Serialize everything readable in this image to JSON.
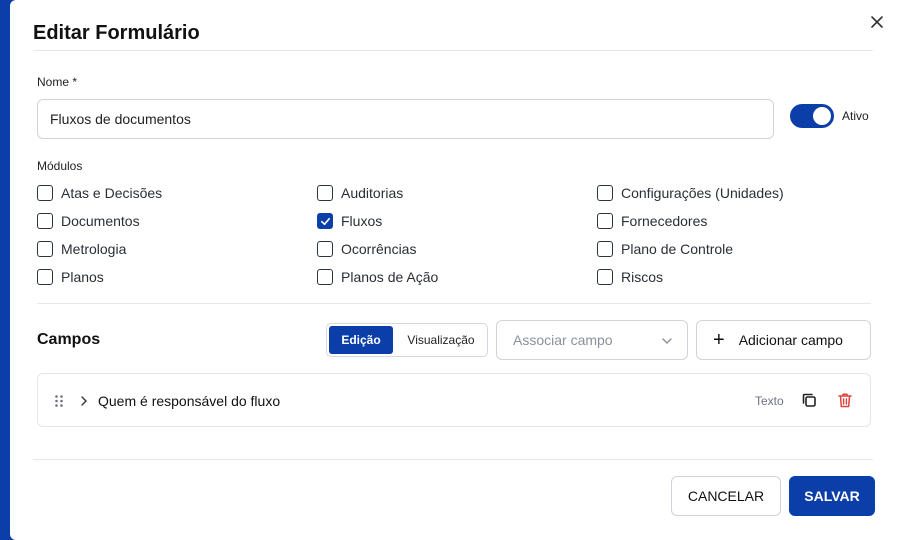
{
  "modal": {
    "title": "Editar Formulário",
    "name_label": "Nome *",
    "name_value": "Fluxos de documentos",
    "toggle_label": "Ativo",
    "toggle_on": true,
    "modules_label": "Módulos",
    "modules": [
      {
        "label": "Atas e Decisões",
        "checked": false
      },
      {
        "label": "Auditorias",
        "checked": false
      },
      {
        "label": "Configurações (Unidades)",
        "checked": false
      },
      {
        "label": "Documentos",
        "checked": false
      },
      {
        "label": "Fluxos",
        "checked": true
      },
      {
        "label": "Fornecedores",
        "checked": false
      },
      {
        "label": "Metrologia",
        "checked": false
      },
      {
        "label": "Ocorrências",
        "checked": false
      },
      {
        "label": "Plano de Controle",
        "checked": false
      },
      {
        "label": "Planos",
        "checked": false
      },
      {
        "label": "Planos de Ação",
        "checked": false
      },
      {
        "label": "Riscos",
        "checked": false
      }
    ],
    "fields_title": "Campos",
    "mode_tabs": {
      "edit": "Edição",
      "view": "Visualização",
      "active": "edit"
    },
    "associate_placeholder": "Associar campo",
    "add_field_label": "Adicionar campo",
    "fields": [
      {
        "name": "Quem é responsável do fluxo",
        "type": "Texto"
      }
    ],
    "cancel_label": "CANCELAR",
    "save_label": "SALVAR"
  },
  "colors": {
    "accent": "#0b3ea8",
    "danger": "#e0413a"
  },
  "icons": [
    "close-icon",
    "check-icon",
    "chevron-down-icon",
    "plus-icon",
    "drag-handle-icon",
    "chevron-right-icon",
    "copy-icon",
    "trash-icon"
  ]
}
